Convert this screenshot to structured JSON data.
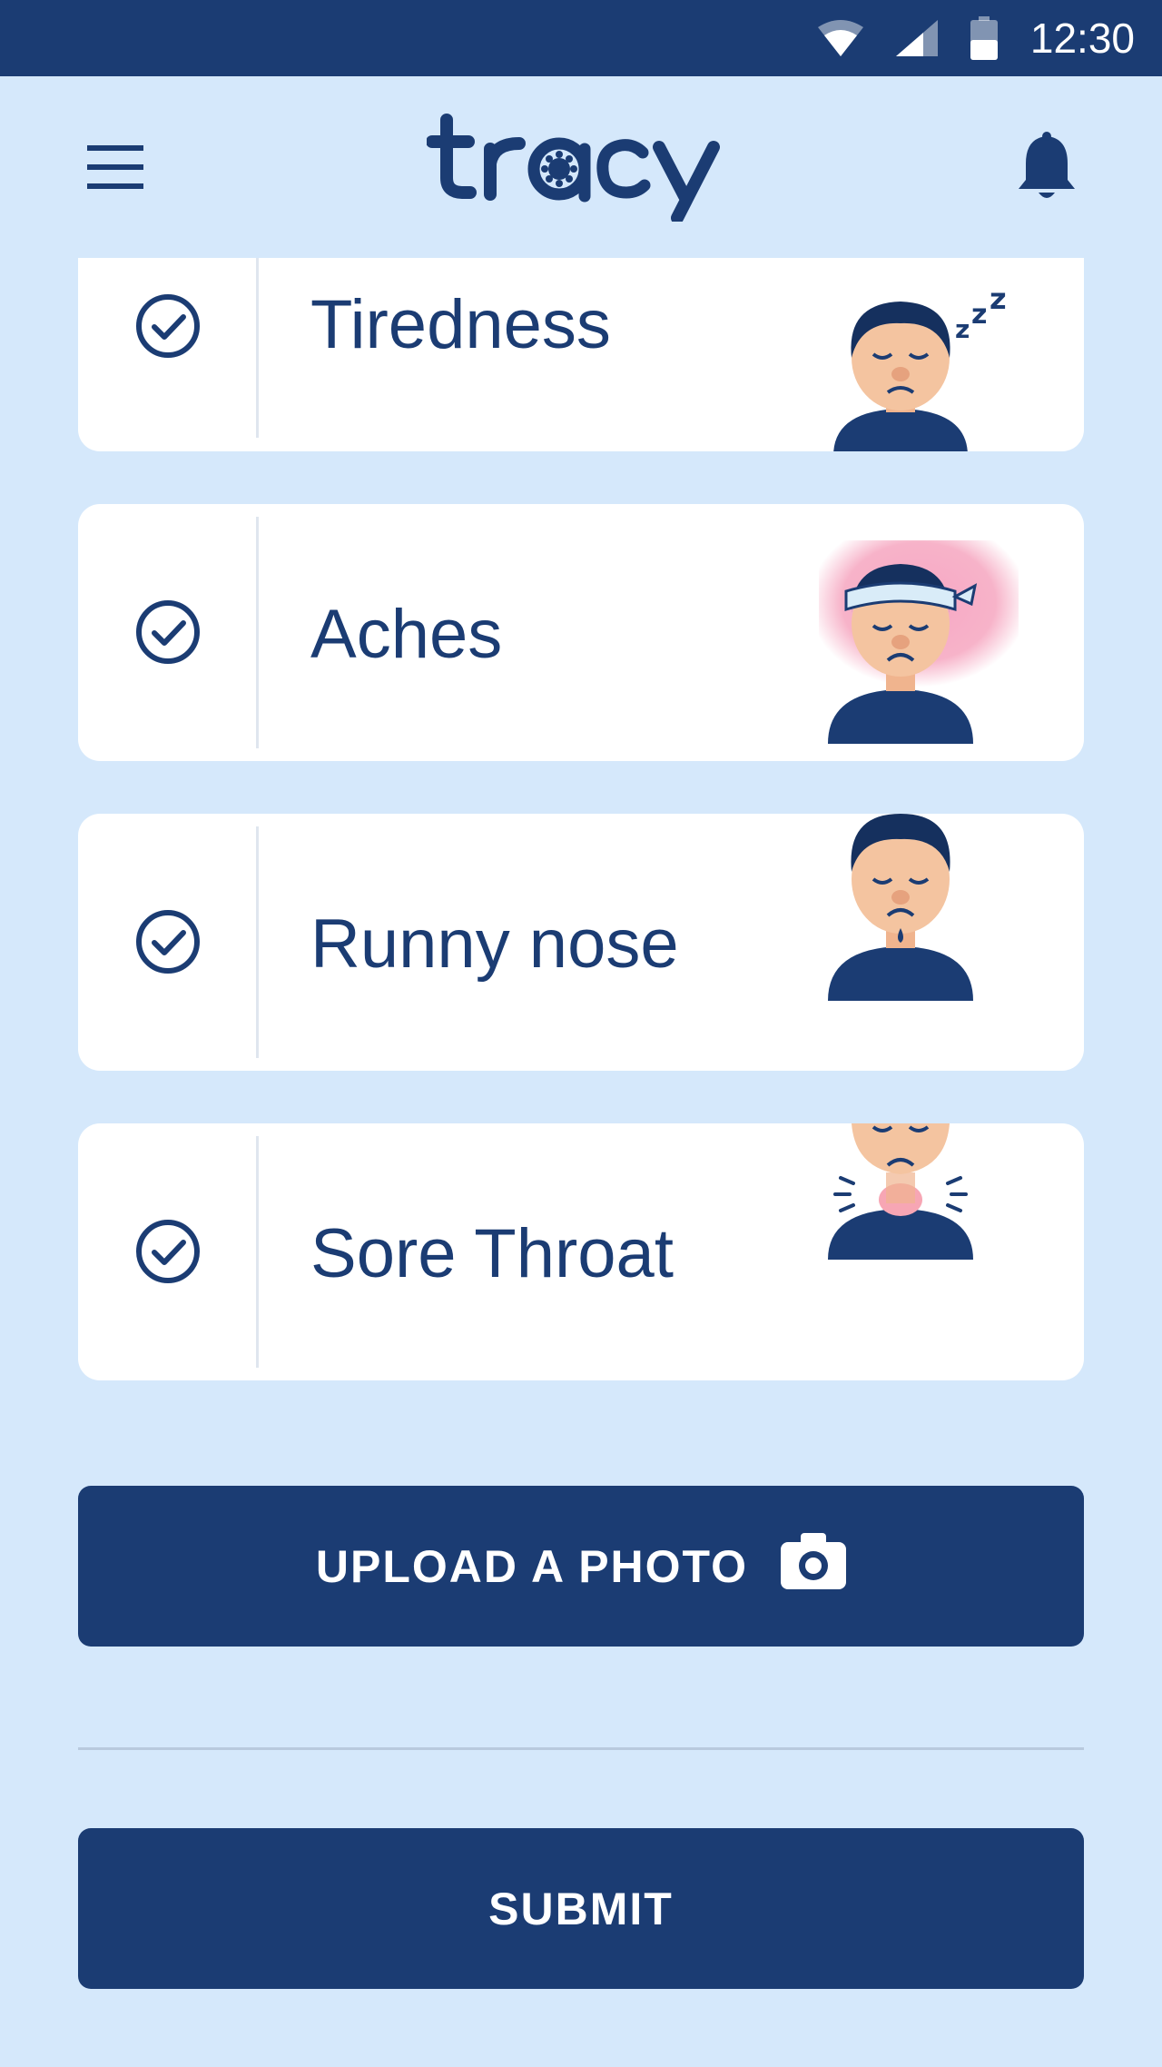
{
  "status_bar": {
    "time": "12:30",
    "icons": [
      "wifi-icon",
      "cell-signal-icon",
      "battery-icon"
    ]
  },
  "header": {
    "logo_text": "tracy",
    "menu_icon": "hamburger-menu-icon",
    "bell_icon": "bell-icon"
  },
  "symptoms": [
    {
      "label": "Tiredness",
      "checked": true,
      "illustration": "tired-person-icon"
    },
    {
      "label": "Aches",
      "checked": true,
      "illustration": "headache-person-icon"
    },
    {
      "label": "Runny nose",
      "checked": true,
      "illustration": "runny-nose-person-icon"
    },
    {
      "label": "Sore Throat",
      "checked": true,
      "illustration": "sore-throat-person-icon"
    }
  ],
  "actions": {
    "upload_label": "UPLOAD A PHOTO",
    "upload_icon": "camera-icon",
    "submit_label": "SUBMIT"
  },
  "colors": {
    "primary": "#1b3c73",
    "background": "#d5e8fb",
    "card": "#ffffff",
    "skin": "#f4c4a0",
    "accent_pink": "#f7b3c9"
  }
}
